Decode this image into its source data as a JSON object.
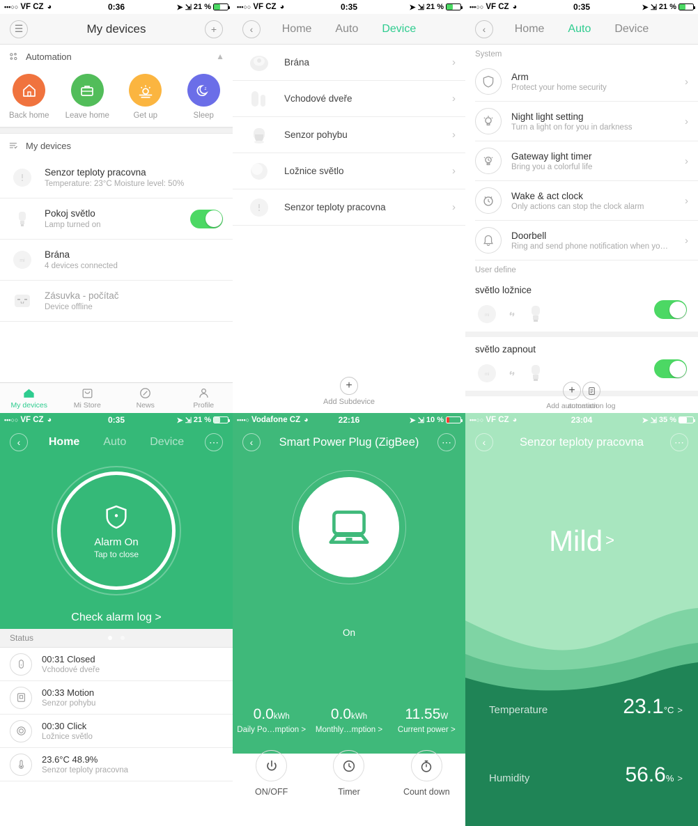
{
  "panel1": {
    "status": {
      "carrier": "VF CZ",
      "dots": "•••○○",
      "time": "0:36",
      "battery": "21 %"
    },
    "nav": {
      "title": "My devices",
      "menu_icon": "hamburger-icon",
      "add_icon": "plus-icon"
    },
    "automation": {
      "section_label": "Automation",
      "items": [
        {
          "label": "Back home",
          "color": "#f0733e",
          "icon": "home-icon"
        },
        {
          "label": "Leave home",
          "color": "#52bd5a",
          "icon": "briefcase-icon"
        },
        {
          "label": "Get up",
          "color": "#fbb540",
          "icon": "sunrise-icon"
        },
        {
          "label": "Sleep",
          "color": "#6b6ee8",
          "icon": "moon-icon"
        }
      ]
    },
    "devices_label": "My devices",
    "devices": [
      {
        "name": "Senzor teploty pracovna",
        "sub": "Temperature: 23°C Moisture level: 50%",
        "icon": "sensor-icon",
        "toggle": false,
        "offline": false
      },
      {
        "name": "Pokoj světlo",
        "sub": "Lamp turned on",
        "icon": "bulb-icon",
        "toggle": true,
        "offline": false
      },
      {
        "name": "Brána",
        "sub": "4 devices connected",
        "icon": "gateway-icon",
        "toggle": false,
        "offline": false
      },
      {
        "name": "Zásuvka - počítač",
        "sub": "Device offline",
        "icon": "socket-icon",
        "toggle": false,
        "offline": true
      }
    ],
    "tabs": [
      {
        "label": "My devices",
        "icon": "home-icon",
        "active": true
      },
      {
        "label": "Mi Store",
        "icon": "bag-icon",
        "active": false
      },
      {
        "label": "News",
        "icon": "compass-icon",
        "active": false
      },
      {
        "label": "Profile",
        "icon": "person-icon",
        "active": false
      }
    ]
  },
  "panel2": {
    "status": {
      "carrier": "VF CZ",
      "dots": "•••○○",
      "time": "0:35",
      "battery": "21 %"
    },
    "nav": {
      "back_icon": "chevron-left-icon",
      "tabs": [
        "Home",
        "Auto",
        "Device"
      ],
      "active": "Device"
    },
    "subdevices": [
      {
        "name": "Brána",
        "icon": "gateway-icon"
      },
      {
        "name": "Vchodové dveře",
        "icon": "door-sensor-icon"
      },
      {
        "name": "Senzor pohybu",
        "icon": "motion-sensor-icon"
      },
      {
        "name": "Ložnice světlo",
        "icon": "button-icon"
      },
      {
        "name": "Senzor teploty pracovna",
        "icon": "sensor-icon"
      }
    ],
    "add_subdevice": "Add Subdevice"
  },
  "panel3": {
    "status": {
      "carrier": "VF CZ",
      "dots": "•••○○",
      "time": "0:35",
      "battery": "21 %"
    },
    "nav": {
      "back_icon": "chevron-left-icon",
      "tabs": [
        "Home",
        "Auto",
        "Device"
      ],
      "active": "Auto"
    },
    "system_label": "System",
    "system": [
      {
        "title": "Arm",
        "sub": "Protect your home security",
        "icon": "shield-icon"
      },
      {
        "title": "Night light setting",
        "sub": "Turn a light on for you in darkness",
        "icon": "night-light-icon"
      },
      {
        "title": "Gateway light timer",
        "sub": "Bring you a colorful life",
        "icon": "light-timer-icon"
      },
      {
        "title": "Wake & act clock",
        "sub": "Only actions can stop the clock alarm",
        "icon": "alarm-clock-icon"
      },
      {
        "title": "Doorbell",
        "sub": "Ring and send phone notification when yo…",
        "icon": "bell-icon"
      }
    ],
    "user_define_label": "User define",
    "user_define": [
      {
        "name": "světlo ložnice",
        "enabled": true
      },
      {
        "name": "světlo zapnout",
        "enabled": true
      }
    ],
    "bottom": [
      {
        "label": "Add automation",
        "icon": "plus-icon"
      },
      {
        "label": "automation log",
        "icon": "log-icon"
      }
    ]
  },
  "panel4": {
    "status": {
      "carrier": "VF CZ",
      "dots": "•••○○",
      "time": "0:35",
      "battery": "21 %"
    },
    "nav": {
      "back_icon": "chevron-left-icon",
      "tabs": [
        "Home",
        "Auto",
        "Device"
      ],
      "active": "Home",
      "more_icon": "more-icon"
    },
    "alarm": {
      "title": "Alarm On",
      "subtitle": "Tap to close",
      "log_link": "Check alarm log >",
      "icon": "shield-icon"
    },
    "status_label": "Status",
    "events": [
      {
        "title": "00:31 Closed",
        "sub": "Vchodové dveře",
        "icon": "door-sensor-icon"
      },
      {
        "title": "00:33 Motion",
        "sub": "Senzor pohybu",
        "icon": "motion-sensor-icon"
      },
      {
        "title": "00:30 Click",
        "sub": "Ložnice světlo",
        "icon": "button-icon"
      },
      {
        "title": "23.6°C 48.9%",
        "sub": "Senzor teploty pracovna",
        "icon": "thermometer-icon"
      }
    ],
    "accent": "#35b978"
  },
  "panel5": {
    "status": {
      "carrier": "Vodafone CZ",
      "dots": "••••○",
      "time": "22:16",
      "battery": "10 %",
      "battery_color": "#ff3b30"
    },
    "nav": {
      "back_icon": "chevron-left-icon",
      "title": "Smart Power Plug (ZigBee)",
      "more_icon": "more-icon"
    },
    "device": {
      "state": "On",
      "icon": "laptop-icon"
    },
    "stats": [
      {
        "value": "0.0",
        "unit": "kWh",
        "label": "Daily Po…mption >"
      },
      {
        "value": "0.0",
        "unit": "kWh",
        "label": "Monthly…mption >"
      },
      {
        "value": "11.55",
        "unit": "W",
        "label": "Current power >"
      }
    ],
    "actions": [
      {
        "label": "ON/OFF",
        "icon": "power-icon"
      },
      {
        "label": "Timer",
        "icon": "clock-icon"
      },
      {
        "label": "Count down",
        "icon": "stopwatch-icon"
      }
    ],
    "accent": "#3fb97a"
  },
  "panel6": {
    "status": {
      "carrier": "VF CZ",
      "dots": "•••○○",
      "time": "23:04",
      "battery": "35 %"
    },
    "nav": {
      "back_icon": "chevron-left-icon",
      "title": "Senzor teploty pracovna",
      "more_icon": "more-icon"
    },
    "condition": "Mild",
    "condition_chevron": ">",
    "readings": [
      {
        "label": "Temperature",
        "value": "23.1",
        "unit": "°C",
        "chevron": ">"
      },
      {
        "label": "Humidity",
        "value": "56.6",
        "unit": "%",
        "chevron": ">"
      }
    ],
    "bg_light": "#a8e6bf",
    "bg_dark": "#1f8456"
  }
}
